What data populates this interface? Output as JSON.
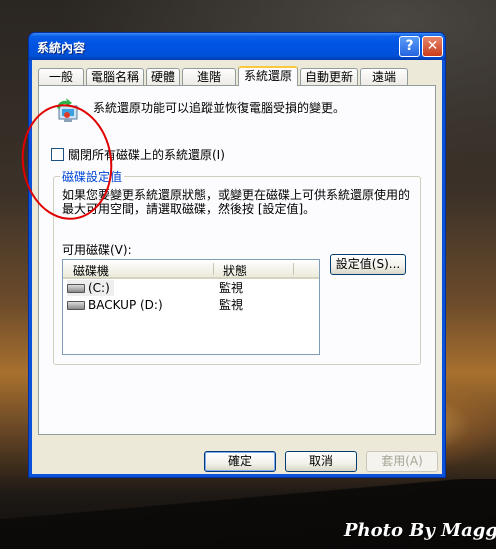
{
  "window": {
    "title": "系統內容"
  },
  "tabs": [
    {
      "label": "一般"
    },
    {
      "label": "電腦名稱"
    },
    {
      "label": "硬體"
    },
    {
      "label": "進階"
    },
    {
      "label": "系統還原"
    },
    {
      "label": "自動更新"
    },
    {
      "label": "遠端"
    }
  ],
  "active_tab": "系統還原",
  "restore": {
    "intro": "系統還原功能可以追蹤並恢復電腦受損的變更。",
    "disable_all_label": "關閉所有磁碟上的系統還原(I)",
    "disable_all_checked": false
  },
  "drive_settings": {
    "group_title": "磁碟設定值",
    "description": "如果您要變更系統還原狀態，或變更在磁碟上可供系統還原使用的最大可用空間，請選取磁碟，然後按 [設定值]。",
    "available_label": "可用磁碟(V):",
    "columns": {
      "drive": "磁碟機",
      "status": "狀態"
    },
    "drives": [
      {
        "name": "(C:)",
        "status": "監視"
      },
      {
        "name": "BACKUP (D:)",
        "status": "監視"
      }
    ],
    "settings_button": "設定值(S)..."
  },
  "buttons": {
    "ok": "確定",
    "cancel": "取消",
    "apply": "套用(A)"
  },
  "watermark": "Photo By Maggie"
}
